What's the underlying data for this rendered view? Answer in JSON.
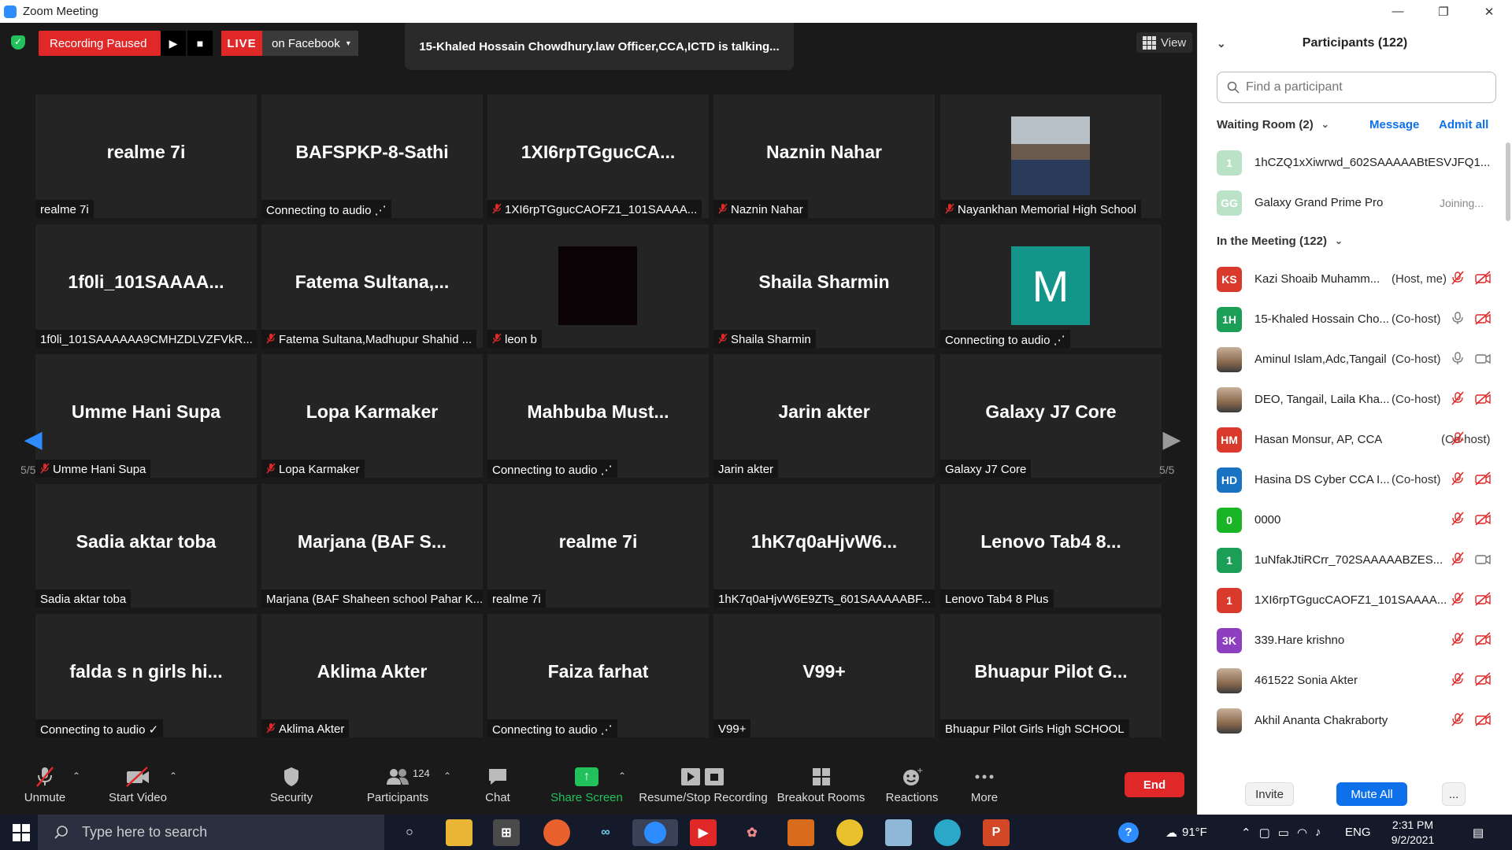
{
  "window": {
    "title": "Zoom Meeting",
    "minimize": "—",
    "restore": "❐",
    "close": "✕"
  },
  "topbar": {
    "recording_status": "Recording Paused",
    "resume_icon": "▶",
    "stop_icon": "■",
    "live_label": "LIVE",
    "live_destination": "on Facebook",
    "caret": "▾",
    "talking": "15-Khaled Hossain Chowdhury.law Officer,CCA,ICTD is talking...",
    "view_label": "View"
  },
  "tiles": [
    {
      "big": "realme 7i",
      "caption": "realme 7i",
      "muted": false,
      "media": "none"
    },
    {
      "big": "BAFSPKP-8-Sathi",
      "caption": "Connecting to audio ⋰",
      "muted": false,
      "media": "none"
    },
    {
      "big": "1XI6rpTGgucCA...",
      "caption": "1XI6rpTGgucCAOFZ1_101SAAAA...",
      "muted": true,
      "media": "none"
    },
    {
      "big": "Naznin Nahar",
      "caption": "Naznin Nahar",
      "muted": true,
      "media": "none"
    },
    {
      "big": "",
      "caption": "Nayankhan Memorial High School",
      "muted": true,
      "media": "photo"
    },
    {
      "big": "1f0li_101SAAAA...",
      "caption": "1f0li_101SAAAAAA9CMHZDLVZFVkR...",
      "muted": false,
      "media": "none"
    },
    {
      "big": "Fatema  Sultana,...",
      "caption": "Fatema Sultana,Madhupur Shahid ...",
      "muted": true,
      "media": "none"
    },
    {
      "big": "",
      "caption": "leon b",
      "muted": true,
      "media": "dark"
    },
    {
      "big": "Shaila Sharmin",
      "caption": "Shaila Sharmin",
      "muted": true,
      "media": "none"
    },
    {
      "big": "",
      "caption": "Connecting to audio ⋰",
      "muted": false,
      "media": "avatar",
      "avatar_letter": "M"
    },
    {
      "big": "Umme Hani Supa",
      "caption": "Umme Hani Supa",
      "muted": true,
      "media": "none"
    },
    {
      "big": "Lopa Karmaker",
      "caption": "Lopa Karmaker",
      "muted": true,
      "media": "none"
    },
    {
      "big": "Mahbuba  Must...",
      "caption": "Connecting to audio ⋰",
      "muted": false,
      "media": "none"
    },
    {
      "big": "Jarin akter",
      "caption": "Jarin akter",
      "muted": false,
      "media": "none"
    },
    {
      "big": "Galaxy J7 Core",
      "caption": "Galaxy J7 Core",
      "muted": false,
      "media": "none"
    },
    {
      "big": "Sadia aktar toba",
      "caption": "Sadia aktar toba",
      "muted": false,
      "media": "none"
    },
    {
      "big": "Marjana  (BAF S...",
      "caption": "Marjana (BAF Shaheen school Pahar K...",
      "muted": false,
      "media": "none"
    },
    {
      "big": "realme 7i",
      "caption": "realme 7i",
      "muted": false,
      "media": "none"
    },
    {
      "big": "1hK7q0aHjvW6...",
      "caption": "1hK7q0aHjvW6E9ZTs_601SAAAAABF...",
      "muted": false,
      "media": "none"
    },
    {
      "big": "Lenovo Tab4 8...",
      "caption": "Lenovo Tab4 8 Plus",
      "muted": false,
      "media": "none"
    },
    {
      "big": "falda s n girls hi...",
      "caption": "Connecting to audio ✓",
      "muted": false,
      "media": "none"
    },
    {
      "big": "Aklima Akter",
      "caption": "Aklima Akter",
      "muted": true,
      "media": "none"
    },
    {
      "big": "Faiza farhat",
      "caption": "Connecting to audio ⋰",
      "muted": false,
      "media": "none"
    },
    {
      "big": "V99+",
      "caption": "V99+",
      "muted": false,
      "media": "none"
    },
    {
      "big": "Bhuapur  Pilot G...",
      "caption": "Bhuapur Pilot Girls High SCHOOL",
      "muted": false,
      "media": "none"
    }
  ],
  "pager": {
    "prev_icon": "◀",
    "next_icon": "▶",
    "left": "5/5",
    "right": "5/5"
  },
  "toolbar": {
    "unmute": "Unmute",
    "start_video": "Start Video",
    "security": "Security",
    "participants": "Participants",
    "participants_count": "124",
    "chat": "Chat",
    "share_screen": "Share Screen",
    "recording": "Resume/Stop Recording",
    "breakout": "Breakout Rooms",
    "reactions": "Reactions",
    "more": "More",
    "end": "End",
    "caret": "⌃"
  },
  "panel": {
    "title": "Participants (122)",
    "collapse_icon": "⌄",
    "search_placeholder": "Find a participant",
    "waiting_title": "Waiting Room (2)",
    "message": "Message",
    "admit_all": "Admit all",
    "waiting": [
      {
        "initials": "1",
        "color": "#b9e2c7",
        "name": "1hCZQ1xXiwrwd_602SAAAAABtESVJFQ1...",
        "status": ""
      },
      {
        "initials": "GG",
        "color": "#b9e2c7",
        "name": "Galaxy Grand Prime Pro",
        "status": "Joining..."
      }
    ],
    "meeting_title": "In the Meeting (122)",
    "participants": [
      {
        "initials": "KS",
        "color": "#d93a2b",
        "name": "Kazi Shoaib Muhamm...",
        "role": "(Host, me)",
        "mic": "off",
        "cam": "off",
        "photo": false
      },
      {
        "initials": "1H",
        "color": "#1b9e56",
        "name": "15-Khaled Hossain Cho...",
        "role": "(Co-host)",
        "mic": "on",
        "cam": "off",
        "photo": false
      },
      {
        "initials": "",
        "color": "#8a6a4e",
        "name": "Aminul Islam,Adc,Tangail",
        "role": "(Co-host)",
        "mic": "on",
        "cam": "on",
        "photo": true
      },
      {
        "initials": "",
        "color": "#8a6a4e",
        "name": "DEO, Tangail, Laila Kha...",
        "role": "(Co-host)",
        "mic": "off",
        "cam": "off",
        "photo": true
      },
      {
        "initials": "HM",
        "color": "#d93a2b",
        "name": "Hasan Monsur, AP, CCA",
        "role": "(Co-host)",
        "mic": "off",
        "cam": "",
        "photo": false
      },
      {
        "initials": "HD",
        "color": "#1a73c2",
        "name": "Hasina DS Cyber CCA I...",
        "role": "(Co-host)",
        "mic": "off",
        "cam": "off",
        "photo": false
      },
      {
        "initials": "0",
        "color": "#1ab526",
        "name": "0000",
        "role": "",
        "mic": "off",
        "cam": "off",
        "photo": false
      },
      {
        "initials": "1",
        "color": "#1b9e56",
        "name": "1uNfakJtiRCrr_702SAAAAABZES...",
        "role": "",
        "mic": "off",
        "cam": "on",
        "photo": false
      },
      {
        "initials": "1",
        "color": "#d93a2b",
        "name": "1XI6rpTGgucCAOFZ1_101SAAAA...",
        "role": "",
        "mic": "off",
        "cam": "off",
        "photo": false
      },
      {
        "initials": "3K",
        "color": "#8d3fbf",
        "name": "339.Hare krishno",
        "role": "",
        "mic": "off",
        "cam": "off",
        "photo": false
      },
      {
        "initials": "",
        "color": "#555555",
        "name": "461522 Sonia Akter",
        "role": "",
        "mic": "off",
        "cam": "off",
        "photo": true
      },
      {
        "initials": "",
        "color": "#555555",
        "name": "Akhil Ananta Chakraborty",
        "role": "",
        "mic": "off",
        "cam": "off",
        "photo": true
      }
    ],
    "invite": "Invite",
    "mute_all": "Mute All",
    "more": "..."
  },
  "taskbar": {
    "search_placeholder": "Type here to search",
    "weather": "91°F",
    "lang": "ENG",
    "time": "2:31 PM",
    "date": "9/2/2021"
  }
}
